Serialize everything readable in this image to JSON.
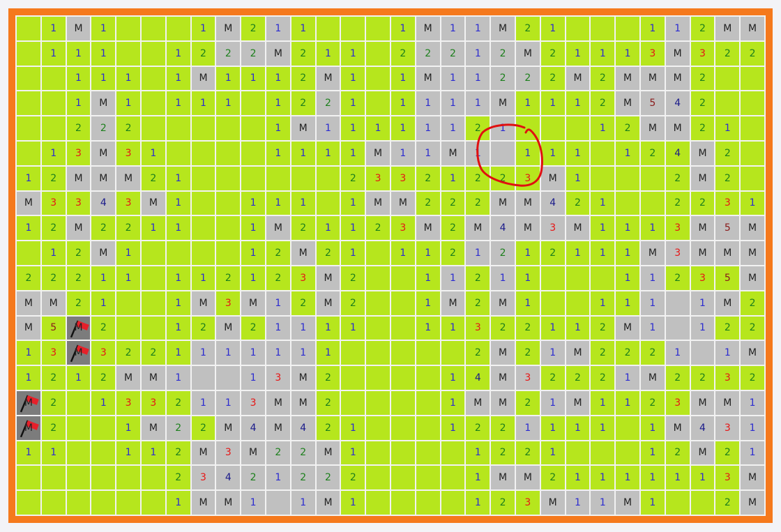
{
  "board": {
    "rows": 20,
    "cols": 30,
    "cells": [
      "h,h1,oM,h1,h,h,h,h1,oM,h2,o1,h1,h,h,h,h1,oM,o1,o1,oM,h2,h1,h,h,h,h1,o1,h2,oM,oM",
      "h,h1,h1,h1,h,h,h1,h2,o2,o2,oM,h2,h1,h1,h,h2,o2,o2,o1,o2,oM,h2,h1,h1,h1,h3,oM,h3,h2,h2",
      "h,h,h1,h1,h1,h,h1,oM,h1,h1,h1,h2,oM,h1,h,h1,oM,o1,o1,o2,o2,h2,oM,h2,oM,oM,oM,h2,h,h",
      "h,h,h1,oM,h1,h,h1,h1,h1,h,h1,h2,o2,h1,h,h1,o1,o1,o1,oM,h1,h1,h1,h2,oM,o5,o4,h2,h,h",
      "h,h,h2,o2,h2,h,h,h,h,h,h1,oM,o1,h1,h1,h1,o1,o1,h2,o1,h,h,h,h1,h2,oM,oM,h2,h1,h",
      "h,h1,h3,oM,h3,h1,h,h,h,h,h1,h1,h1,h1,oM,o1,o1,oM,o1,o,h1,h1,h1,h,h1,h2,h4,oM,h2,h",
      "h1,h2,oM,oM,oM,h2,h1,h,h,h,h,h,h,h2,h3,h3,h2,h1,h2,h2,h3,oM,h1,h,h,h,h2,oM,h2,h",
      "oM,h3,h3,o4,h3,oM,h1,h,h,h1,h1,h1,h,h1,oM,oM,h2,h2,h2,oM,oM,o4,h2,h1,h,h,h2,h2,h3,h1",
      "h1,h2,oM,h2,h2,h1,h1,h,h,h1,oM,h2,h1,h1,h2,h3,oM,h2,oM,o4,oM,o3,oM,h1,h1,h1,h3,oM,o5,oM",
      "h,h1,h2,oM,h1,h,h,h,h,h1,h2,oM,h2,h1,h,h1,h1,h2,o1,o2,h1,h2,h1,h1,h1,oM,o3,oM,oM,oM",
      "h2,h2,h2,h1,h1,h,h1,h1,h2,h1,h2,h3,oM,h2,h,h,h1,o1,h2,o1,h1,h,h,h,h1,o1,h2,h3,h5,oM",
      "oM,oM,h2,h1,h,h,h1,oM,h3,oM,o1,h2,oM,h2,h,h,h1,oM,h2,oM,h1,h,h,h1,h1,o1,o,o1,oM,h2",
      "oM,h5,fM,h2,h,h,h1,h2,oM,h2,o1,o1,h1,h1,h,h,h1,h1,h3,h2,h2,h1,h1,h2,oM,o1,o,o1,h2,h2",
      "h1,h3,fM,h3,h2,h2,h1,o1,o1,o1,o1,o1,h1,h,h,h,h,h,h2,oM,h2,o1,oM,h2,h2,h2,o1,o,o1,oM",
      "h1,h2,h1,h2,oM,oM,o1,o,o,o1,o3,oM,h2,h,h,h,h,h1,h4,oM,o3,h2,h2,h2,o1,oM,h2,h2,h3,h2",
      "fM,h2,h,h1,h3,h3,h2,o1,o1,o3,oM,oM,h2,h,h,h,h,h1,oM,oM,h2,o1,oM,h1,h1,h2,h3,oM,oM,o1",
      "fM,h2,h,h,h1,oM,o2,h2,oM,o4,oM,o4,h2,h1,h,h,h,h1,h2,h2,o1,h1,h1,h1,h,h1,oM,o4,o3,o1",
      "h1,h1,h,h,h1,h1,h2,oM,o3,oM,o2,o2,oM,h1,h,h,h,h,h1,h2,h2,h1,h,h,h,h1,h2,oM,h2,o1",
      "h,h,h,h,h,h,h2,o3,o4,o2,o1,o2,o2,h2,h,h,h,h,h1,oM,oM,h2,h1,h1,h1,h1,h1,h1,h3,oM",
      "h,h,h,h,h,h,h1,oM,oM,o1,o,o1,oM,h1,h,h,h,h,h1,h2,h3,oM,o1,o1,oM,h1,h,h,h2,oM"
    ]
  },
  "colors": {
    "frame": "#f5791d",
    "hidden": "#b6e61d",
    "open": "#c0c0c0",
    "flagged": "#7c7c7c",
    "grid": "#f2f2f2",
    "annotation": "#e01010",
    "n1": "#2b2bd0",
    "n2": "#1c7f1c",
    "n3": "#e61515",
    "n4": "#1a1a8a",
    "n5": "#8a1a1a"
  },
  "icons": {
    "flag": "flag-icon",
    "annotation": "red-hand-drawn-circle"
  }
}
